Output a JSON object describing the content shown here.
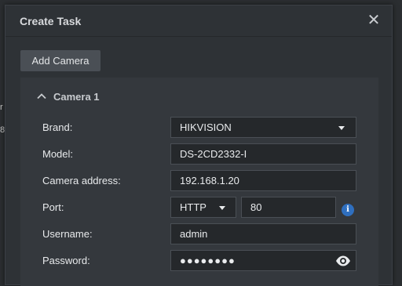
{
  "background": {
    "glyphs": [
      "r",
      "8"
    ]
  },
  "dialog": {
    "title": "Create Task",
    "close_icon": "close-icon",
    "add_camera_label": "Add Camera"
  },
  "camera": {
    "title": "Camera 1",
    "collapse_icon": "chevron-up-icon",
    "fields": {
      "brand_label": "Brand:",
      "brand_value": "HIKVISION",
      "model_label": "Model:",
      "model_value": "DS-2CD2332-I",
      "address_label": "Camera address:",
      "address_value": "192.168.1.20",
      "port_label": "Port:",
      "port_protocol": "HTTP",
      "port_value": "80",
      "username_label": "Username:",
      "username_value": "admin",
      "password_label": "Password:",
      "password_value": "●●●●●●●●"
    }
  },
  "colors": {
    "accent_info": "#2f6fbf",
    "panel": "#34383d",
    "field_bg": "#25282b"
  }
}
